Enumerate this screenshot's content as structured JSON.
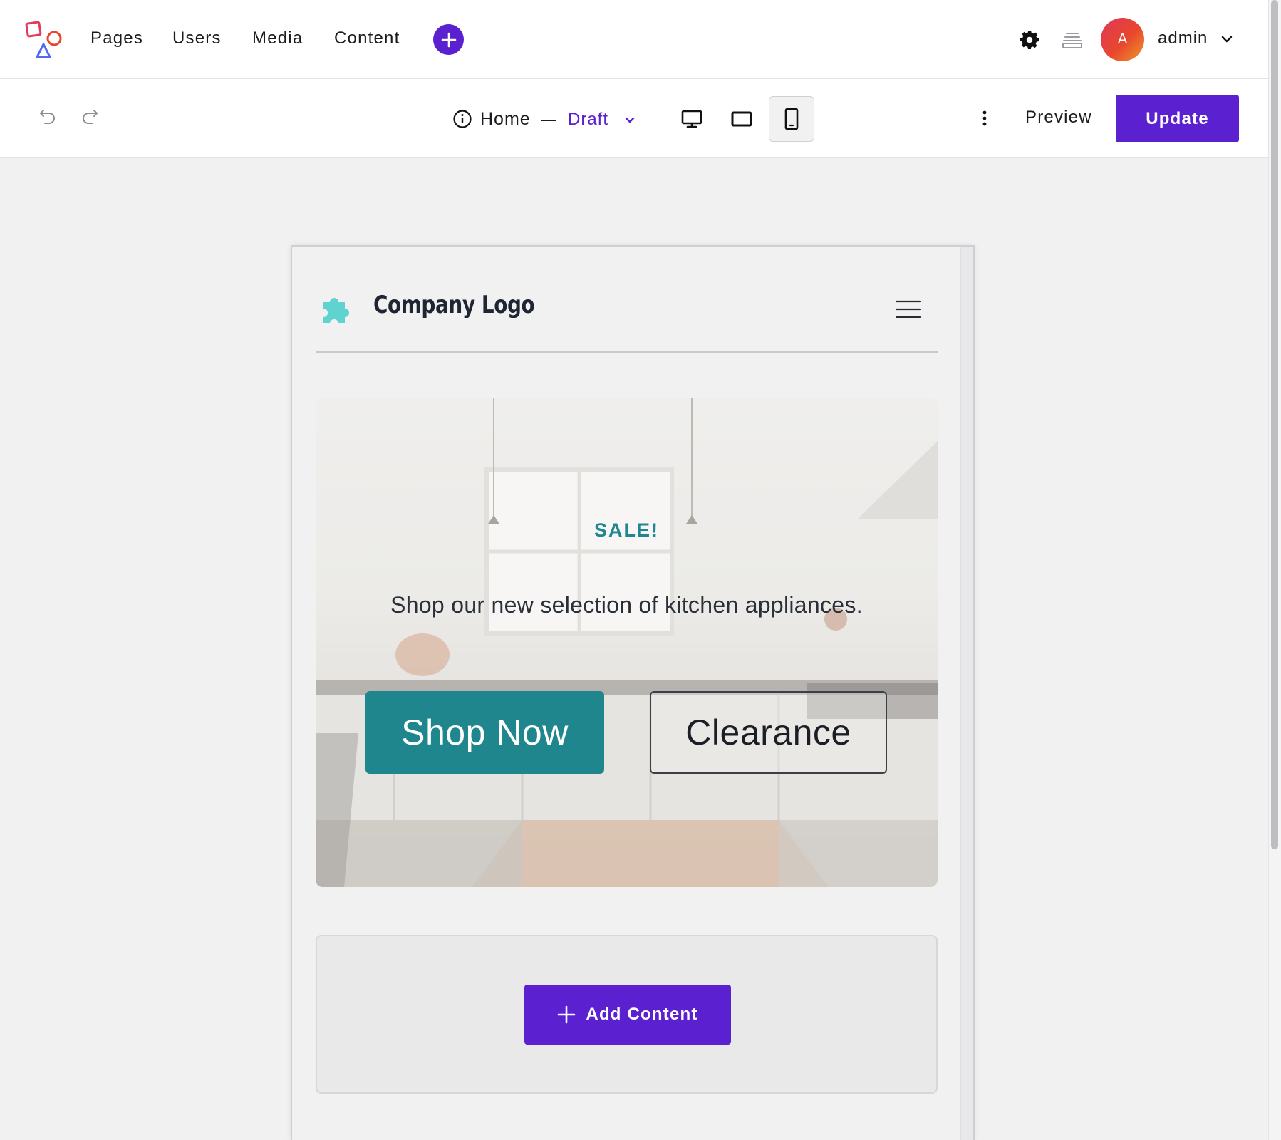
{
  "nav": {
    "items": [
      {
        "label": "Pages"
      },
      {
        "label": "Users"
      },
      {
        "label": "Media"
      },
      {
        "label": "Content"
      }
    ],
    "user": {
      "initial": "A",
      "name": "admin"
    }
  },
  "toolbar": {
    "page_name": "Home",
    "status": "Draft",
    "preview_label": "Preview",
    "update_label": "Update",
    "active_device": "mobile"
  },
  "canvas": {
    "logo_text": "Company Logo",
    "hero": {
      "eyebrow": "SALE!",
      "text": "Shop our new selection of kitchen appliances.",
      "primary_button": "Shop Now",
      "secondary_button": "Clearance"
    },
    "add_content_label": "Add Content"
  },
  "colors": {
    "accent": "#5b21d1",
    "teal": "#1f868e",
    "puzzle_icon": "#5fd3d0"
  }
}
